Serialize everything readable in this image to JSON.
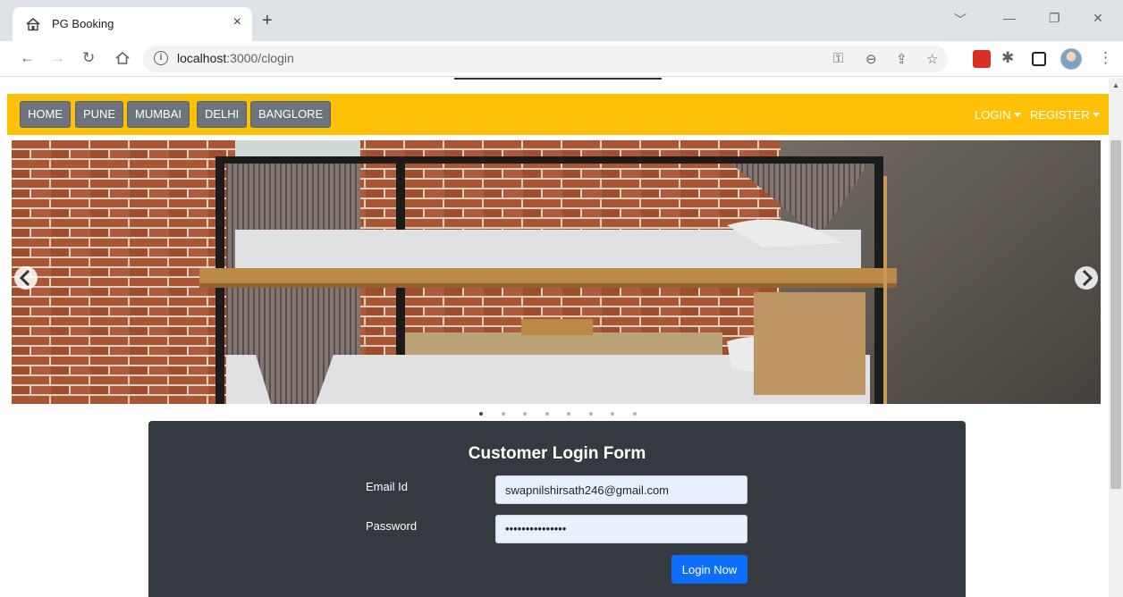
{
  "browser": {
    "tab_title": "PG Booking",
    "tab_close": "×",
    "new_tab": "+",
    "url_host": "localhost",
    "url_path": ":3000/clogin",
    "controls": {
      "collapse": "﹀",
      "minimize": "—",
      "restore": "❐",
      "close": "✕"
    }
  },
  "navbar": {
    "bg_color": "#ffc107",
    "links": [
      "HOME",
      "PUNE",
      "MUMBAI",
      "DELHI",
      "BANGLORE"
    ],
    "login": "LOGIN",
    "register": "REGISTER"
  },
  "carousel": {
    "slide_count": 8,
    "active_index": 0
  },
  "login_form": {
    "title": "Customer Login Form",
    "email_label": "Email Id",
    "email_value": "swapnilshirsath246@gmail.com",
    "password_label": "Password",
    "password_value": "•••••••••••••••",
    "submit": "Login Now",
    "submit_color": "#0d6efd"
  }
}
